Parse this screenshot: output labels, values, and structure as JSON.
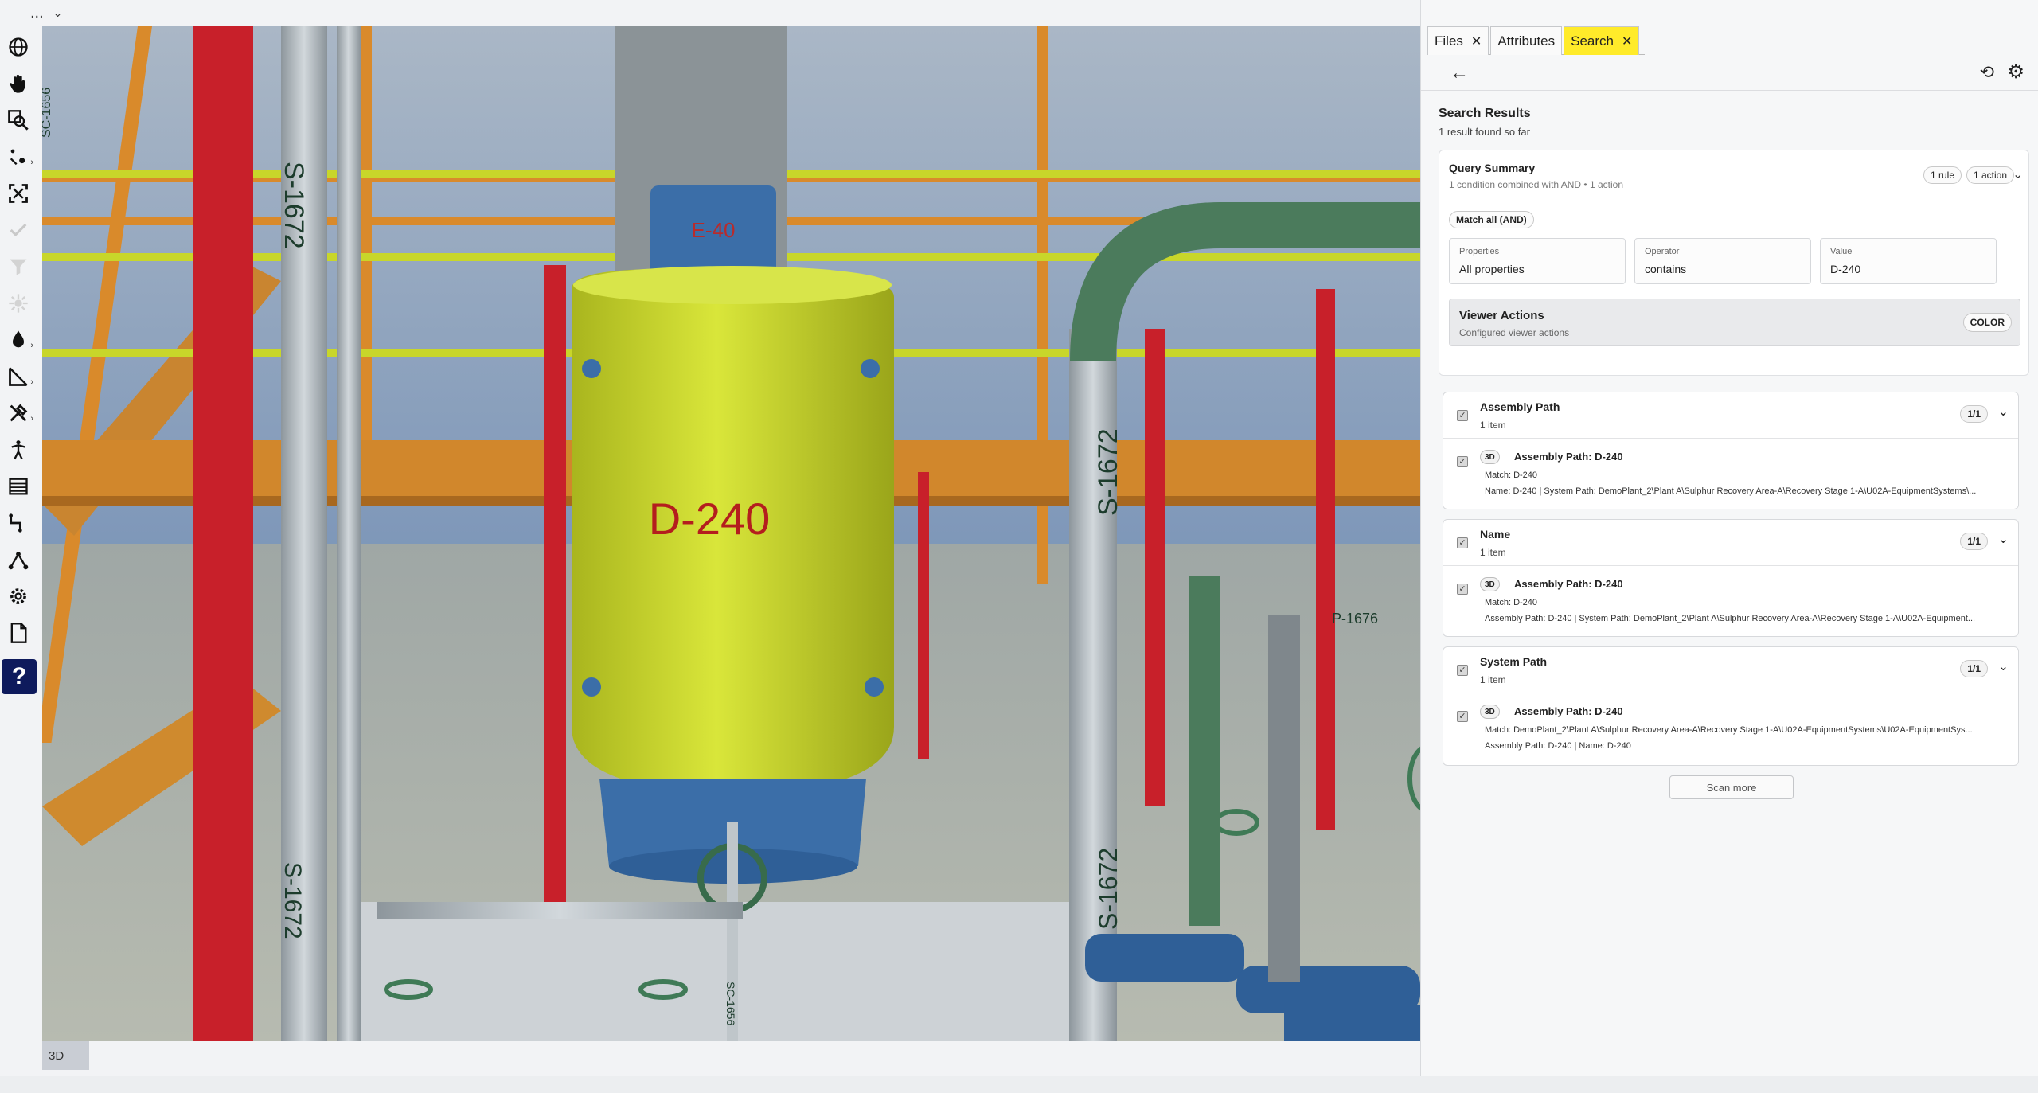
{
  "topbar": {
    "menu_label": "...",
    "chevron": "⌄"
  },
  "toolbar": {
    "tools": [
      {
        "name": "globe-icon"
      },
      {
        "name": "pan-hand-icon"
      },
      {
        "name": "zoom-area-icon"
      },
      {
        "name": "orbit-point-icon"
      },
      {
        "name": "fit-view-icon"
      },
      {
        "name": "check-icon"
      },
      {
        "name": "filter-icon"
      },
      {
        "name": "explode-icon"
      },
      {
        "name": "color-drop-icon"
      },
      {
        "name": "measure-icon"
      },
      {
        "name": "tools-icon"
      },
      {
        "name": "walk-icon"
      },
      {
        "name": "list-icon"
      },
      {
        "name": "route-icon"
      },
      {
        "name": "graph-icon"
      },
      {
        "name": "settings-icon"
      },
      {
        "name": "document-icon"
      },
      {
        "name": "help-icon"
      }
    ],
    "help_label": "?"
  },
  "viewport": {
    "tags": {
      "d240": "D-240",
      "e40": "E-40",
      "s1672a": "S-1672",
      "s1672b": "S-1672",
      "s1672c": "S-1672",
      "s1672d": "S-1672",
      "sc1656": "SC-1656",
      "sc1656b": "SC-1656",
      "p1676": "P-1676"
    },
    "badge": "3D"
  },
  "panel": {
    "tabs": [
      {
        "label": "Files",
        "close": "✕"
      },
      {
        "label": "Attributes"
      },
      {
        "label": "Search",
        "close": "✕"
      }
    ],
    "back": "←",
    "history_icon": "⟲",
    "gear_icon": "⚙",
    "results_title": "Search Results",
    "results_sub": "1 result found so far",
    "query": {
      "title": "Query Summary",
      "sub": "1 condition combined with AND • 1 action",
      "rule_pill": "1 rule",
      "action_pill": "1 action",
      "caret": "⌄",
      "match": "Match all (AND)",
      "fields": [
        {
          "label": "Properties",
          "value": "All properties"
        },
        {
          "label": "Operator",
          "value": "contains"
        },
        {
          "label": "Value",
          "value": "D-240"
        }
      ],
      "viewer_actions_title": "Viewer Actions",
      "viewer_actions_sub": "Configured viewer actions",
      "color_label": "COLOR"
    },
    "groups": [
      {
        "title": "Assembly Path",
        "count": "1 item",
        "badge": "1/1",
        "item": {
          "badge": "3D",
          "title": "Assembly Path: D-240",
          "line1": "Match: D-240",
          "line2": "Name: D-240 | System Path: DemoPlant_2\\Plant A\\Sulphur Recovery Area-A\\Recovery Stage 1-A\\U02A-EquipmentSystems\\..."
        }
      },
      {
        "title": "Name",
        "count": "1 item",
        "badge": "1/1",
        "item": {
          "badge": "3D",
          "title": "Assembly Path: D-240",
          "line1": "Match: D-240",
          "line2": "Assembly Path: D-240 | System Path: DemoPlant_2\\Plant A\\Sulphur Recovery Area-A\\Recovery Stage 1-A\\U02A-Equipment..."
        }
      },
      {
        "title": "System Path",
        "count": "1 item",
        "badge": "1/1",
        "item": {
          "badge": "3D",
          "title": "Assembly Path: D-240",
          "line1": "Match: DemoPlant_2\\Plant A\\Sulphur Recovery Area-A\\Recovery Stage 1-A\\U02A-EquipmentSystems\\U02A-EquipmentSys...",
          "line2": "Assembly Path: D-240 | Name: D-240"
        }
      }
    ],
    "scan_more": "Scan more"
  },
  "colors": {
    "accent_tab": "#ffeb2a",
    "help_bg": "#0e1a5c",
    "vessel": "#cfe02b",
    "red_steel": "#c8202a",
    "orange_steel": "#d98a2b"
  }
}
